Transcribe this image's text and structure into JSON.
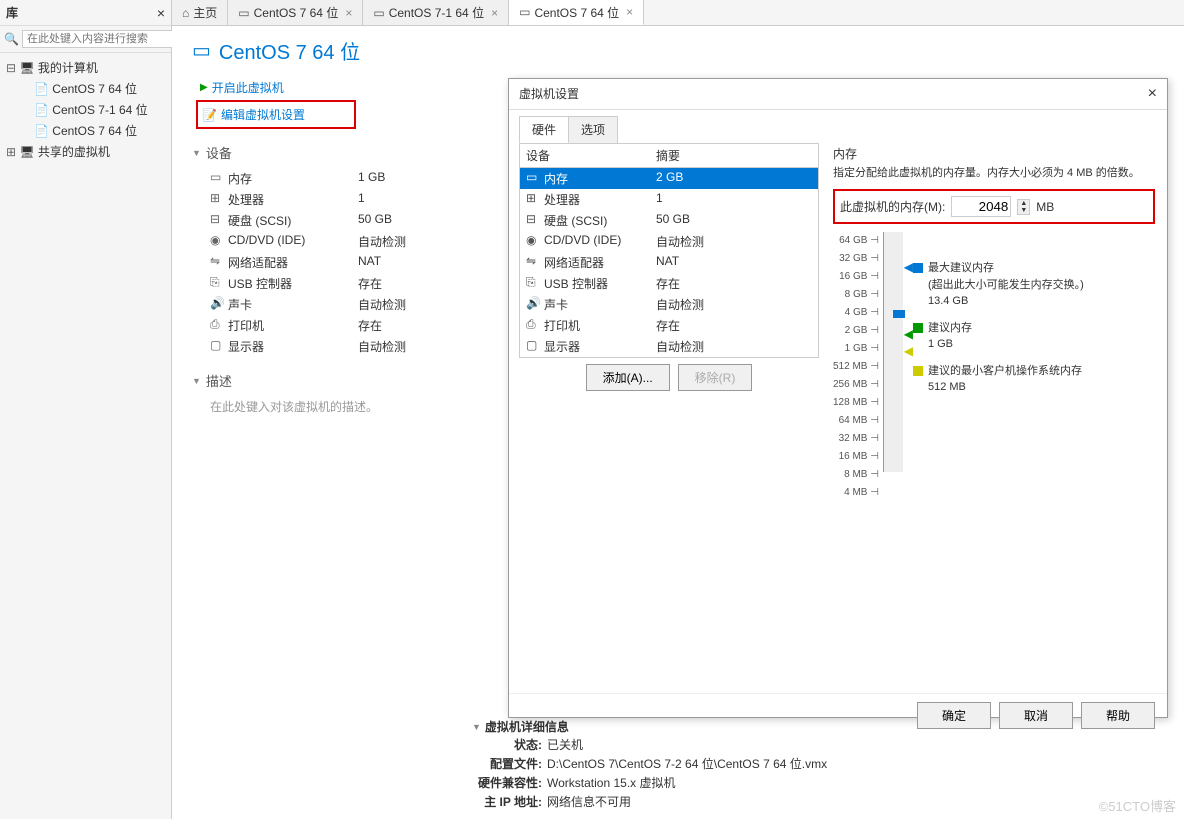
{
  "sidebar": {
    "title": "库",
    "search_placeholder": "在此处键入内容进行搜索",
    "tree": {
      "root": "我的计算机",
      "items": [
        "CentOS 7 64 位",
        "CentOS 7-1 64 位",
        "CentOS 7 64 位"
      ],
      "shared": "共享的虚拟机"
    }
  },
  "tabs": {
    "home": "主页",
    "items": [
      "CentOS 7 64 位",
      "CentOS 7-1 64 位",
      "CentOS 7 64 位"
    ]
  },
  "page": {
    "title": "CentOS 7 64 位",
    "actions": {
      "power_on": "开启此虚拟机",
      "edit_settings": "编辑虚拟机设置"
    }
  },
  "sections": {
    "devices": "设备",
    "description": "描述",
    "desc_placeholder": "在此处键入对该虚拟机的描述。"
  },
  "devices": [
    {
      "icon": "mem",
      "name": "内存",
      "value": "1 GB"
    },
    {
      "icon": "cpu",
      "name": "处理器",
      "value": "1"
    },
    {
      "icon": "hdd",
      "name": "硬盘 (SCSI)",
      "value": "50 GB"
    },
    {
      "icon": "cd",
      "name": "CD/DVD (IDE)",
      "value": "自动检测"
    },
    {
      "icon": "net",
      "name": "网络适配器",
      "value": "NAT"
    },
    {
      "icon": "usb",
      "name": "USB 控制器",
      "value": "存在"
    },
    {
      "icon": "snd",
      "name": "声卡",
      "value": "自动检测"
    },
    {
      "icon": "prn",
      "name": "打印机",
      "value": "存在"
    },
    {
      "icon": "dsp",
      "name": "显示器",
      "value": "自动检测"
    }
  ],
  "vm_details": {
    "header": "虚拟机详细信息",
    "rows": {
      "state_l": "状态:",
      "state_v": "已关机",
      "cfg_l": "配置文件:",
      "cfg_v": "D:\\CentOS 7\\CentOS 7-2 64 位\\CentOS 7 64 位.vmx",
      "compat_l": "硬件兼容性:",
      "compat_v": "Workstation 15.x 虚拟机",
      "ip_l": "主 IP 地址:",
      "ip_v": "网络信息不可用"
    }
  },
  "dialog": {
    "title": "虚拟机设置",
    "tab_hw": "硬件",
    "tab_opt": "选项",
    "hw_col_device": "设备",
    "hw_col_summary": "摘要",
    "hw_list": [
      {
        "icon": "mem",
        "name": "内存",
        "value": "2 GB",
        "sel": true
      },
      {
        "icon": "cpu",
        "name": "处理器",
        "value": "1"
      },
      {
        "icon": "hdd",
        "name": "硬盘 (SCSI)",
        "value": "50 GB"
      },
      {
        "icon": "cd",
        "name": "CD/DVD (IDE)",
        "value": "自动检测"
      },
      {
        "icon": "net",
        "name": "网络适配器",
        "value": "NAT"
      },
      {
        "icon": "usb",
        "name": "USB 控制器",
        "value": "存在"
      },
      {
        "icon": "snd",
        "name": "声卡",
        "value": "自动检测"
      },
      {
        "icon": "prn",
        "name": "打印机",
        "value": "存在"
      },
      {
        "icon": "dsp",
        "name": "显示器",
        "value": "自动检测"
      }
    ],
    "add_btn": "添加(A)...",
    "remove_btn": "移除(R)",
    "mem": {
      "title": "内存",
      "desc": "指定分配给此虚拟机的内存量。内存大小必须为 4 MB 的倍数。",
      "label": "此虚拟机的内存(M):",
      "value": "2048",
      "unit": "MB",
      "ticks": [
        "64 GB",
        "32 GB",
        "16 GB",
        "8 GB",
        "4 GB",
        "2 GB",
        "1 GB",
        "512 MB",
        "256 MB",
        "128 MB",
        "64 MB",
        "32 MB",
        "16 MB",
        "8 MB",
        "4 MB"
      ],
      "legend": {
        "max_l": "最大建议内存",
        "max_d": "(超出此大小可能发生内存交换。)",
        "max_v": "13.4 GB",
        "rec_l": "建议内存",
        "rec_v": "1 GB",
        "min_l": "建议的最小客户机操作系统内存",
        "min_v": "512 MB"
      }
    },
    "ok": "确定",
    "cancel": "取消",
    "help": "帮助"
  },
  "icons": {
    "mem": "▭",
    "cpu": "⊞",
    "hdd": "⊟",
    "cd": "◉",
    "net": "⇋",
    "usb": "⎘",
    "snd": "🔊",
    "prn": "⎙",
    "dsp": "▢"
  },
  "watermark": "©51CTO博客"
}
